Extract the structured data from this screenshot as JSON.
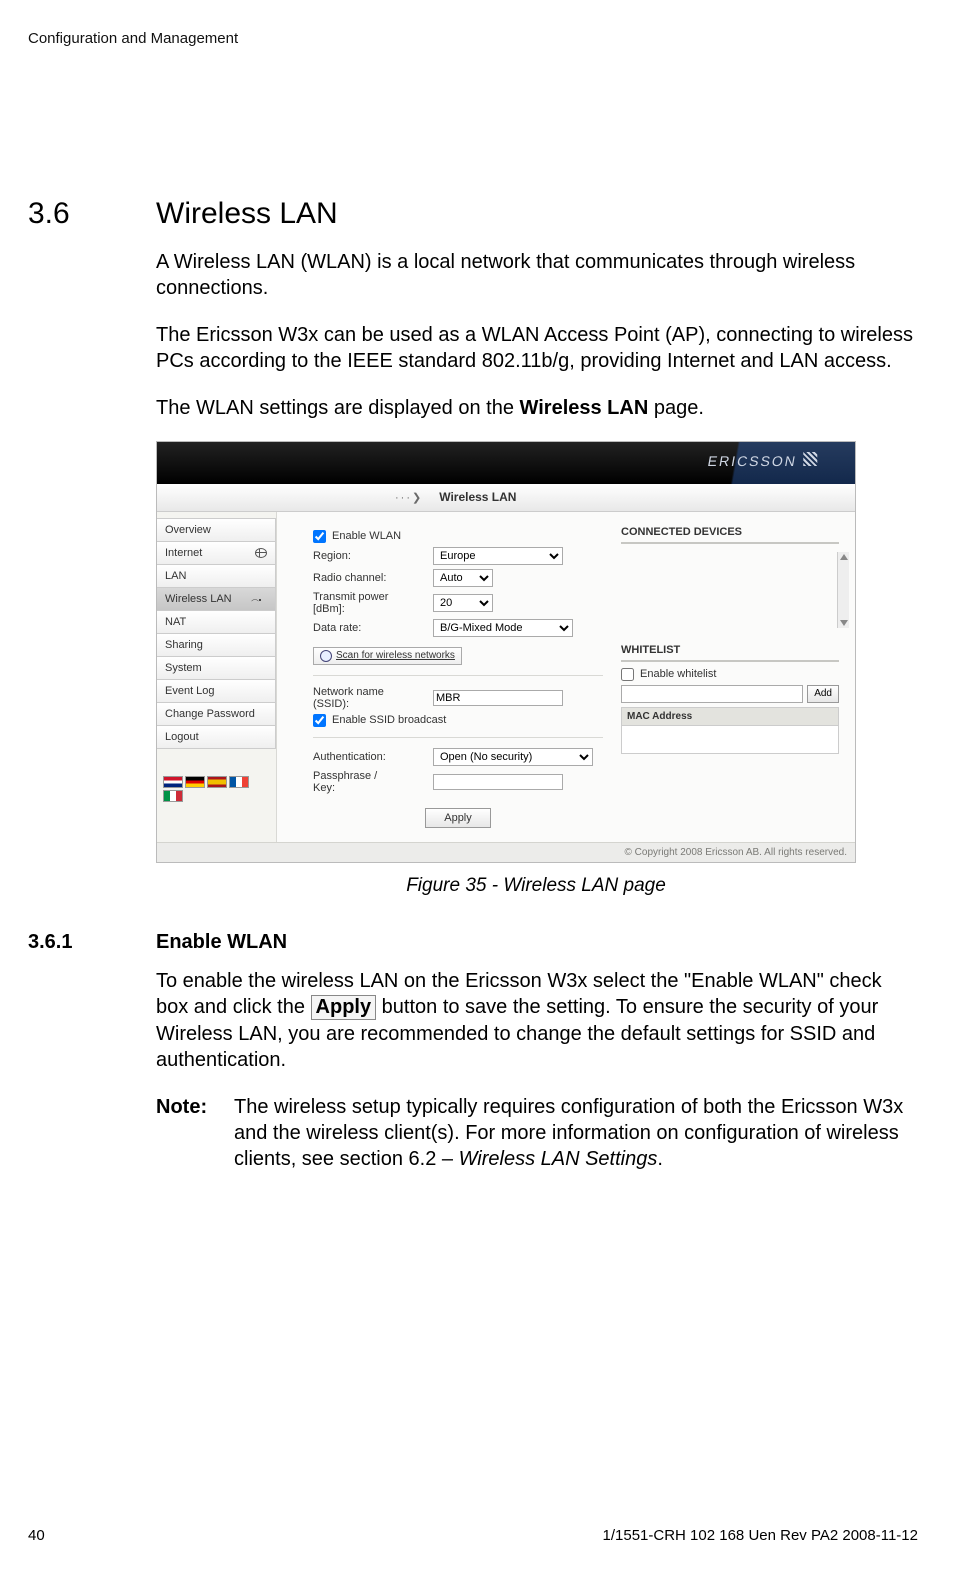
{
  "header": {
    "running": "Configuration and Management"
  },
  "section": {
    "num": "3.6",
    "title": "Wireless LAN"
  },
  "paras": {
    "p1": "A Wireless LAN (WLAN) is a local network that communicates through wireless connections.",
    "p2": "The Ericsson W3x can be used as a WLAN Access Point (AP), connecting to wireless PCs according to the IEEE standard 802.11b/g, providing Internet and LAN access.",
    "p3_a": "The WLAN settings are displayed on the ",
    "p3_b": "Wireless LAN",
    "p3_c": " page."
  },
  "figure": {
    "brand": "ERICSSON",
    "toolbar_pointer": "···❯",
    "toolbar_title": "Wireless LAN",
    "side_items": [
      "Overview",
      "Internet",
      "LAN",
      "Wireless LAN",
      "NAT",
      "Sharing",
      "System",
      "Event Log",
      "Change Password",
      "Logout"
    ],
    "side_selected_index": 3,
    "form": {
      "enable_wlan_label": "Enable WLAN",
      "enable_wlan_checked": true,
      "region_label": "Region:",
      "region_value": "Europe",
      "radio_label": "Radio channel:",
      "radio_value": "Auto",
      "tx_label_a": "Transmit power",
      "tx_label_b": "[dBm]:",
      "tx_value": "20",
      "rate_label": "Data rate:",
      "rate_value": "B/G-Mixed Mode",
      "scan_label": "Scan for wireless networks",
      "ssid_label_a": "Network name",
      "ssid_label_b": "(SSID):",
      "ssid_value": "MBR",
      "enable_ssid_broadcast_label": "Enable SSID broadcast",
      "enable_ssid_broadcast_checked": true,
      "auth_label": "Authentication:",
      "auth_value": "Open (No security)",
      "pass_label_a": "Passphrase /",
      "pass_label_b": "Key:",
      "pass_value": "",
      "apply_btn": "Apply"
    },
    "right": {
      "connected_title": "CONNECTED DEVICES",
      "whitelist_title": "WHITELIST",
      "enable_whitelist_label": "Enable whitelist",
      "enable_whitelist_checked": false,
      "add_btn": "Add",
      "mac_header": "MAC Address"
    },
    "copyright": "© Copyright 2008 Ericsson AB. All rights reserved."
  },
  "caption": "Figure 35 - Wireless LAN page",
  "subsection": {
    "num": "3.6.1",
    "title": "Enable WLAN"
  },
  "sub_paras": {
    "s1_a": "To enable the wireless LAN on the Ericsson W3x select the \"Enable WLAN\" check box and click the ",
    "s1_apply": "Apply",
    "s1_b": " button to save the setting. To ensure the security of your Wireless LAN, you are recommended to change the default settings for SSID and authentication.",
    "note_label": "Note:",
    "note_a": "The wireless setup typically requires configuration of both the Ericsson W3x and the wireless client(s). For more information on configuration of wireless clients, see section 6.2 – ",
    "note_em": "Wireless LAN Settings",
    "note_b": "."
  },
  "footer": {
    "page": "40",
    "docid": "1/1551-CRH 102 168 Uen Rev PA2  2008-11-12"
  }
}
